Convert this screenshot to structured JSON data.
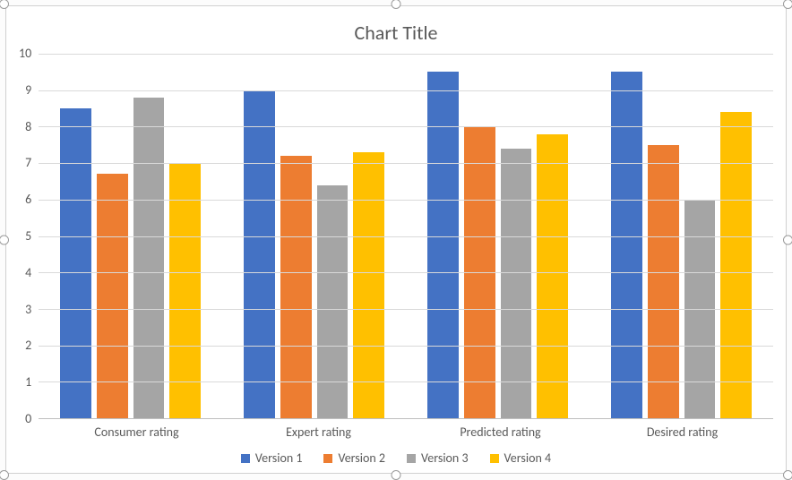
{
  "chart_data": {
    "type": "bar",
    "title": "Chart Title",
    "xlabel": "",
    "ylabel": "",
    "ylim": [
      0,
      10
    ],
    "y_ticks": [
      0,
      1,
      2,
      3,
      4,
      5,
      6,
      7,
      8,
      9,
      10
    ],
    "categories": [
      "Consumer rating",
      "Expert rating",
      "Predicted rating",
      "Desired rating"
    ],
    "series": [
      {
        "name": "Version 1",
        "color": "#4472C4",
        "values": [
          8.5,
          9.0,
          9.5,
          9.5
        ]
      },
      {
        "name": "Version 2",
        "color": "#ED7D31",
        "values": [
          6.7,
          7.2,
          8.0,
          7.5
        ]
      },
      {
        "name": "Version 3",
        "color": "#A5A5A5",
        "values": [
          8.8,
          6.4,
          7.4,
          6.0
        ]
      },
      {
        "name": "Version 4",
        "color": "#FFC000",
        "values": [
          7.0,
          7.3,
          7.8,
          8.4
        ]
      }
    ],
    "legend_position": "bottom",
    "grid": true
  }
}
